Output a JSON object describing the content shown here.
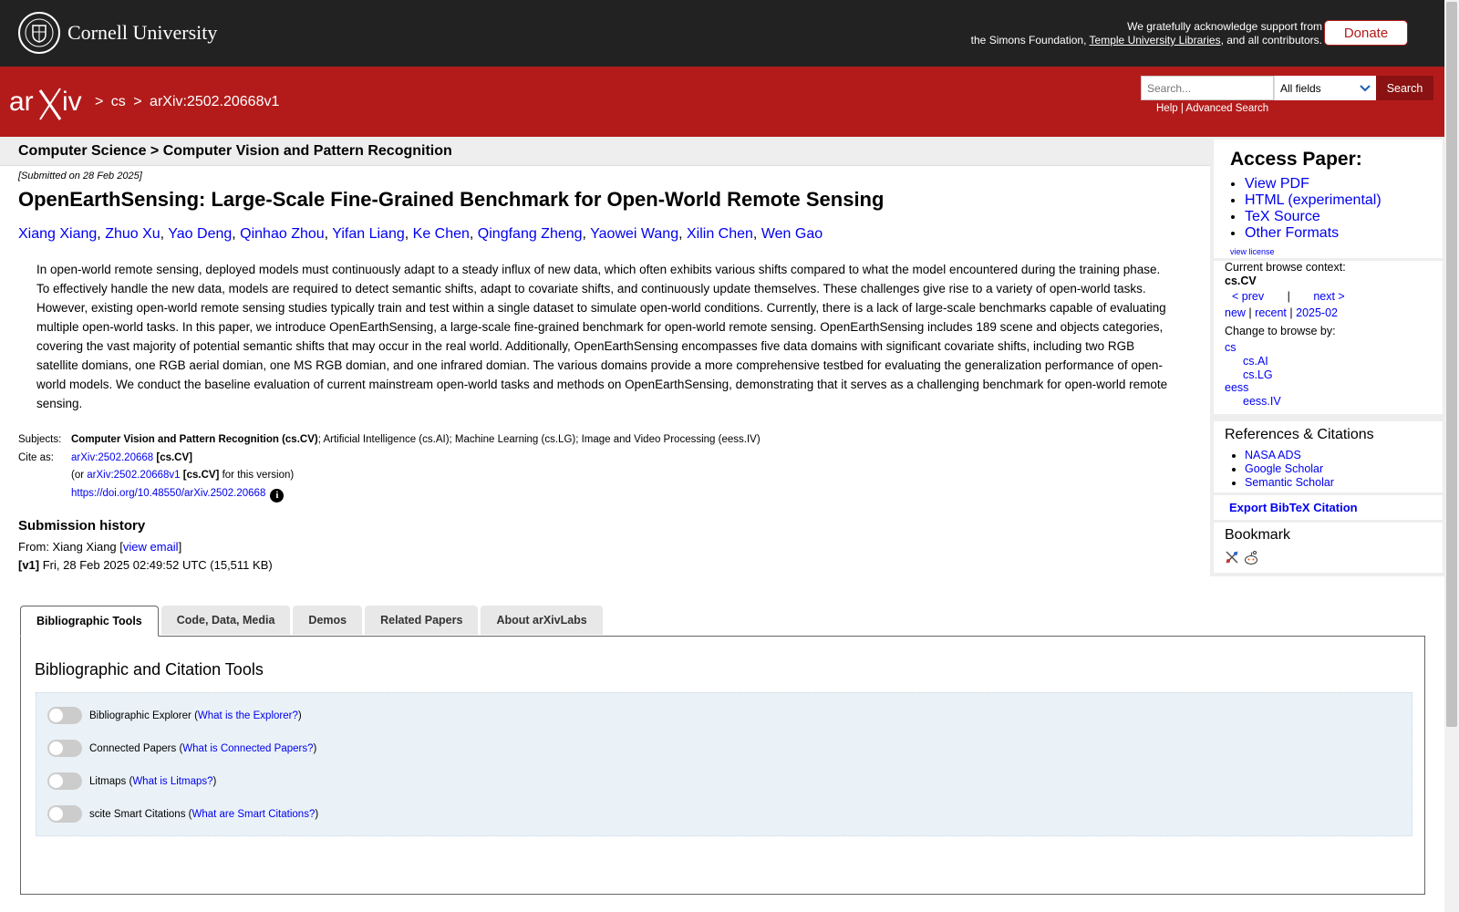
{
  "top_banner": {
    "university": "Cornell University",
    "ack_line1": "We gratefully acknowledge support from",
    "ack_line2_prefix": "the Simons Foundation, ",
    "ack_line2_link": "Temple University Libraries",
    "ack_line2_suffix": ", and all contributors.",
    "donate_label": "Donate"
  },
  "header": {
    "logo_text": "arXiv",
    "breadcrumb": [
      {
        "sep": ">",
        "label": "cs"
      },
      {
        "sep": ">",
        "label": "arXiv:2502.20668v1"
      }
    ],
    "search_placeholder": "Search...",
    "search_field": "All fields",
    "search_button": "Search",
    "help_link": "Help",
    "advanced_link": "Advanced Search",
    "link_sep": "|"
  },
  "context_bar": "Computer Science > Computer Vision and Pattern Recognition",
  "paper": {
    "dateline": "[Submitted on 28 Feb 2025]",
    "title": "OpenEarthSensing: Large-Scale Fine-Grained Benchmark for Open-World Remote Sensing",
    "authors": [
      "Xiang Xiang",
      "Zhuo Xu",
      "Yao Deng",
      "Qinhao Zhou",
      "Yifan Liang",
      "Ke Chen",
      "Qingfang Zheng",
      "Yaowei Wang",
      "Xilin Chen",
      "Wen Gao"
    ],
    "abstract": "In open-world remote sensing, deployed models must continuously adapt to a steady influx of new data, which often exhibits various shifts compared to what the model encountered during the training phase. To effectively handle the new data, models are required to detect semantic shifts, adapt to covariate shifts, and continuously update themselves. These challenges give rise to a variety of open-world tasks. However, existing open-world remote sensing studies typically train and test within a single dataset to simulate open-world conditions. Currently, there is a lack of large-scale benchmarks capable of evaluating multiple open-world tasks. In this paper, we introduce OpenEarthSensing, a large-scale fine-grained benchmark for open-world remote sensing. OpenEarthSensing includes 189 scene and objects categories, covering the vast majority of potential semantic shifts that may occur in the real world. Additionally, OpenEarthSensing encompasses five data domains with significant covariate shifts, including two RGB satellite domians, one RGB aerial domian, one MS RGB domian, and one infrared domian. The various domains provide a more comprehensive testbed for evaluating the generalization performance of open-world models. We conduct the baseline evaluation of current mainstream open-world tasks and methods on OpenEarthSensing, demonstrating that it serves as a challenging benchmark for open-world remote sensing."
  },
  "meta": {
    "subjects_label": "Subjects:",
    "subjects_primary": "Computer Vision and Pattern Recognition (cs.CV)",
    "subjects_rest": "; Artificial Intelligence (cs.AI); Machine Learning (cs.LG); Image and Video Processing (eess.IV)",
    "cite_label": "Cite as:",
    "cite_id": "arXiv:2502.20668",
    "cite_tag": "[cs.CV]",
    "cite_version_prefix": "(or ",
    "cite_version_id": "arXiv:2502.20668v1",
    "cite_version_tag": "[cs.CV]",
    "cite_version_suffix": " for this version)",
    "doi": "https://doi.org/10.48550/arXiv.2502.20668",
    "info_glyph": "i"
  },
  "submission": {
    "heading": "Submission history",
    "from_prefix": "From: Xiang Xiang [",
    "view_email": "view email",
    "from_suffix": "]",
    "v1_label": "[v1]",
    "v1_text": " Fri, 28 Feb 2025 02:49:52 UTC (15,511 KB)"
  },
  "sidebar": {
    "access_title": "Access Paper:",
    "access_links": [
      "View PDF",
      "HTML (experimental)",
      "TeX Source",
      "Other Formats"
    ],
    "view_license": "view license",
    "browse_context_label": "Current browse context:",
    "browse_context": "cs.CV",
    "prev": "< prev",
    "nav_sep": "|",
    "next": "next >",
    "new": "new",
    "recent": "recent",
    "month": "2025-02",
    "change_label": "Change to browse by:",
    "browse_items": [
      {
        "label": "cs",
        "indent": false
      },
      {
        "label": "cs.AI",
        "indent": true
      },
      {
        "label": "cs.LG",
        "indent": true
      },
      {
        "label": "eess",
        "indent": false
      },
      {
        "label": "eess.IV",
        "indent": true
      }
    ],
    "refs_title": "References & Citations",
    "refs_links": [
      "NASA ADS",
      "Google Scholar",
      "Semantic Scholar"
    ],
    "export_bibtex": "Export BibTeX Citation",
    "bookmark_title": "Bookmark"
  },
  "tabs": [
    "Bibliographic Tools",
    "Code, Data, Media",
    "Demos",
    "Related Papers",
    "About arXivLabs"
  ],
  "active_tab": 0,
  "panel": {
    "title": "Bibliographic and Citation Tools",
    "toggles": [
      {
        "label": "Bibliographic Explorer",
        "help": "What is the Explorer?",
        "on": false
      },
      {
        "label": "Connected Papers",
        "help": "What is Connected Papers?",
        "on": false
      },
      {
        "label": "Litmaps",
        "help": "What is Litmaps?",
        "on": false
      },
      {
        "label": "scite Smart Citations",
        "help": "What are Smart Citations?",
        "on": false
      }
    ]
  },
  "colors": {
    "arxiv_red": "#b31b1b",
    "banner_dark": "#222222",
    "link_blue": "#0000ee"
  }
}
